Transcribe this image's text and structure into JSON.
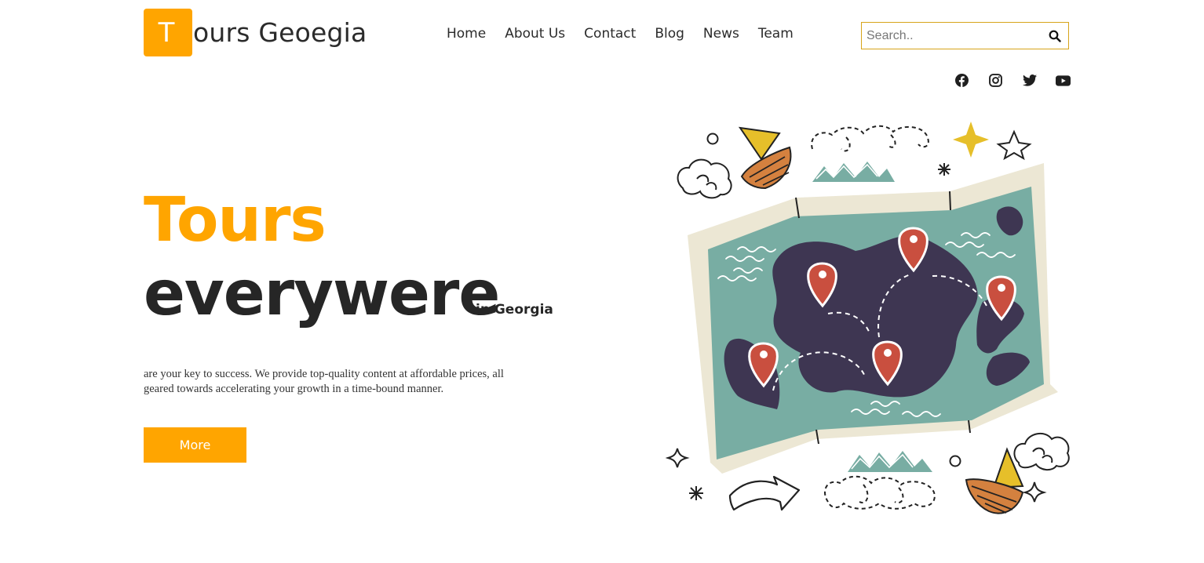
{
  "header": {
    "logo_letter": "T",
    "logo_text": "ours Geoegia",
    "accent_color": "#ffa500"
  },
  "nav": {
    "items": [
      "Home",
      "About Us",
      "Contact",
      "Blog",
      "News",
      "Team"
    ]
  },
  "search": {
    "placeholder": "Search..",
    "icon": "search-icon"
  },
  "social": {
    "icons": [
      "facebook-icon",
      "instagram-icon",
      "twitter-icon",
      "youtube-icon"
    ]
  },
  "hero": {
    "title_line1": "Tours",
    "title_line2": "everywere",
    "subtitle": "in Georgia",
    "description": "are your key to success. We provide top-quality content at affordable prices, all geared towards accelerating your growth in a time-bound manner.",
    "button_label": "More"
  },
  "illustration": {
    "subject": "map-with-location-pins",
    "colors": {
      "map_water": "#78ada3",
      "map_border": "#ece7d4",
      "land": "#3e3652",
      "pin": "#c94f3f",
      "sail": "#e6bf2a",
      "boat": "#d4813f"
    }
  }
}
